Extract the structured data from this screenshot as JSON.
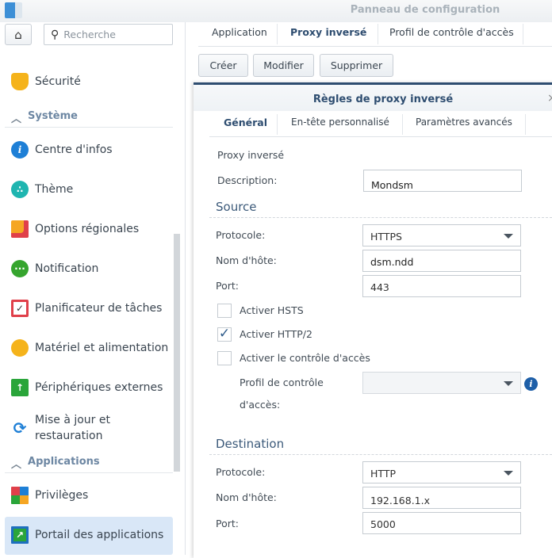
{
  "window": {
    "title": "Panneau de configuration"
  },
  "search": {
    "placeholder": "Recherche"
  },
  "sidebar": {
    "items": [
      {
        "label": "Sécurité",
        "icon": "shield-icon",
        "color": "#f5b31b"
      },
      {
        "label": "Centre d'infos",
        "icon": "info-icon",
        "color": "#1e7fd6"
      },
      {
        "label": "Thème",
        "icon": "palette-icon",
        "color": "#1fb5b0"
      },
      {
        "label": "Options régionales",
        "icon": "map-clock-icon",
        "color": "#f5a623"
      },
      {
        "label": "Notification",
        "icon": "chat-bubble-icon",
        "color": "#36a52e"
      },
      {
        "label": "Planificateur de tâches",
        "icon": "calendar-check-icon",
        "color": "#e0404a"
      },
      {
        "label": "Matériel et alimentation",
        "icon": "lightbulb-icon",
        "color": "#f5b31b"
      },
      {
        "label": "Périphériques externes",
        "icon": "upload-icon",
        "color": "#2aa53a"
      },
      {
        "label": "Mise à jour et",
        "label2": "restauration",
        "icon": "refresh-icon",
        "color": "#1e7fd6"
      },
      {
        "label": "Privilèges",
        "icon": "grid-icon",
        "color": "#e0404a"
      },
      {
        "label": "Portail des applications",
        "icon": "portal-arrow-icon",
        "color": "#1e6fbf"
      }
    ],
    "sections": [
      "Système",
      "Applications"
    ]
  },
  "tabs": [
    "Application",
    "Proxy inversé",
    "Profil de contrôle d'accès"
  ],
  "toolbar": {
    "create": "Créer",
    "modify": "Modifier",
    "delete": "Supprimer"
  },
  "dialog": {
    "title": "Règles de proxy inversé",
    "tabs": [
      "Général",
      "En-tête personnalisé",
      "Paramètres avancés"
    ],
    "proxy_label": "Proxy inversé",
    "description_label": "Description:",
    "description_value": "Mondsm",
    "source": {
      "title": "Source",
      "protocol_label": "Protocole:",
      "protocol": "HTTPS",
      "host_label": "Nom d'hôte:",
      "host": "dsm.ndd",
      "port_label": "Port:",
      "port": "443"
    },
    "checkboxes": [
      {
        "label": "Activer HSTS",
        "checked": false
      },
      {
        "label": "Activer HTTP/2",
        "checked": true
      },
      {
        "label": "Activer le contrôle d'accès",
        "checked": false
      }
    ],
    "profile_label1": "Profil de contrôle",
    "profile_label2": "d'accès:",
    "destination": {
      "title": "Destination",
      "protocol_label": "Protocole:",
      "protocol": "HTTP",
      "host_label": "Nom d'hôte:",
      "host": "192.168.1.x",
      "port_label": "Port:",
      "port": "5000"
    }
  }
}
